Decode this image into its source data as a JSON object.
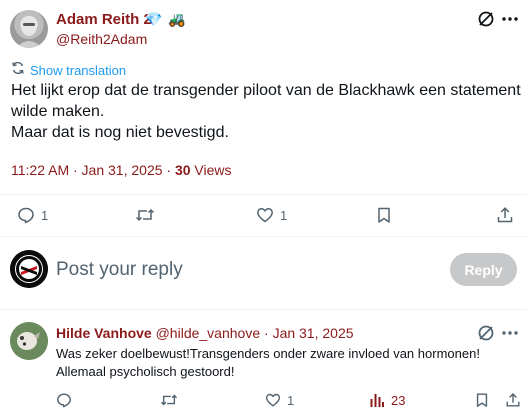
{
  "post": {
    "author_name": "Adam Reith 2",
    "badges": {
      "first": "💎",
      "second": "🚜"
    },
    "handle": "@Reith2Adam",
    "show_translation": "Show translation",
    "body_lines": [
      "Het lijkt erop dat de transgender piloot van de Blackhawk een statement",
      "wilde maken.",
      "Maar dat is nog niet bevestigd."
    ],
    "timestamp": "11:22 AM · Jan 31, 2025 · ",
    "views_count": "30",
    "views_label": " Views",
    "actions": {
      "reply_count": "1",
      "repost_count": "",
      "like_count": "1"
    }
  },
  "reply_box": {
    "placeholder": "Post your reply",
    "button_label": "Reply"
  },
  "reply_tweet": {
    "author_name": "Hilde Vanhove",
    "handle": "@hilde_vanhove",
    "separator": " · ",
    "date": "Jan 31, 2025",
    "body_lines": [
      "Was zeker doelbewust!Transgenders onder zware invloed van hormonen!",
      "Allemaal psycholisch gestoord!"
    ],
    "actions": {
      "reply_count": "",
      "repost_count": "",
      "like_count": "1",
      "views_count": "23"
    }
  },
  "colors": {
    "name_accent": "#8b1a1a",
    "link_blue": "#1d9bf0",
    "icon_gray": "#536471",
    "reply_button_disabled": "#c6c8c9"
  }
}
